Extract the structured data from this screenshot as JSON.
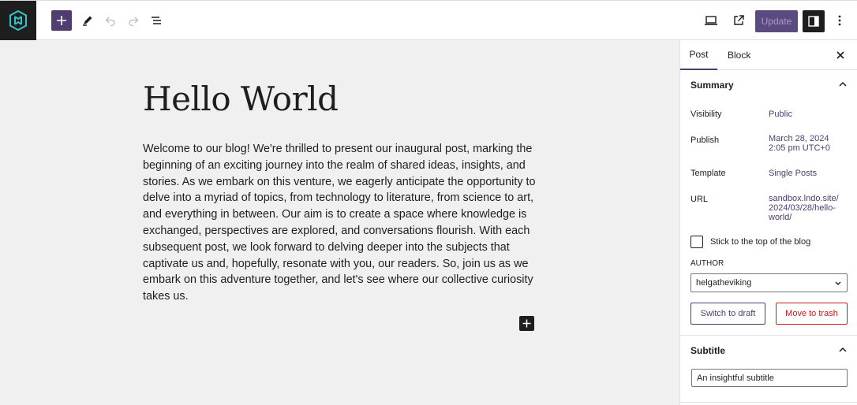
{
  "toolbar": {
    "update_label": "Update"
  },
  "post": {
    "title": "Hello World",
    "body": "Welcome to our blog! We're thrilled to present our inaugural post, marking the beginning of an exciting journey into the realm of shared ideas, insights, and stories. As we embark on this venture, we eagerly anticipate the opportunity to delve into a myriad of topics, from technology to literature, from science to art, and everything in between. Our aim is to create a space where knowledge is exchanged, perspectives are explored, and conversations flourish. With each subsequent post, we look forward to delving deeper into the subjects that captivate us and, hopefully, resonate with you, our readers. So, join us as we embark on this adventure together, and let's see where our collective curiosity takes us."
  },
  "sidebar": {
    "tabs": [
      {
        "label": "Post"
      },
      {
        "label": "Block"
      }
    ],
    "summary": {
      "heading": "Summary",
      "rows": [
        {
          "label": "Visibility",
          "value": "Public"
        },
        {
          "label": "Publish",
          "value_line1": "March 28, 2024",
          "value_line2": "2:05 pm UTC+0"
        },
        {
          "label": "Template",
          "value": "Single Posts"
        },
        {
          "label": "URL",
          "value_line1": "sandbox.lndo.site/",
          "value_line2": "2024/03/28/hello-",
          "value_line3": "world/"
        }
      ],
      "sticky_label": "Stick to the top of the blog",
      "author_label": "AUTHOR",
      "author_value": "helgatheviking",
      "switch_draft_label": "Switch to draft",
      "trash_label": "Move to trash"
    },
    "subtitle": {
      "heading": "Subtitle",
      "value": "An insightful subtitle"
    }
  },
  "colors": {
    "accent": "#4f3d6f",
    "danger": "#cc1818",
    "dark": "#1e1e1e",
    "canvas": "#f0f0f0"
  },
  "icons": [
    "site-logo-icon",
    "plus-icon",
    "pencil-icon",
    "undo-icon",
    "redo-icon",
    "list-view-icon",
    "desktop-preview-icon",
    "external-link-icon",
    "sidebar-icon",
    "more-vertical-icon",
    "close-icon",
    "chevron-up-icon",
    "chevron-down-icon"
  ]
}
